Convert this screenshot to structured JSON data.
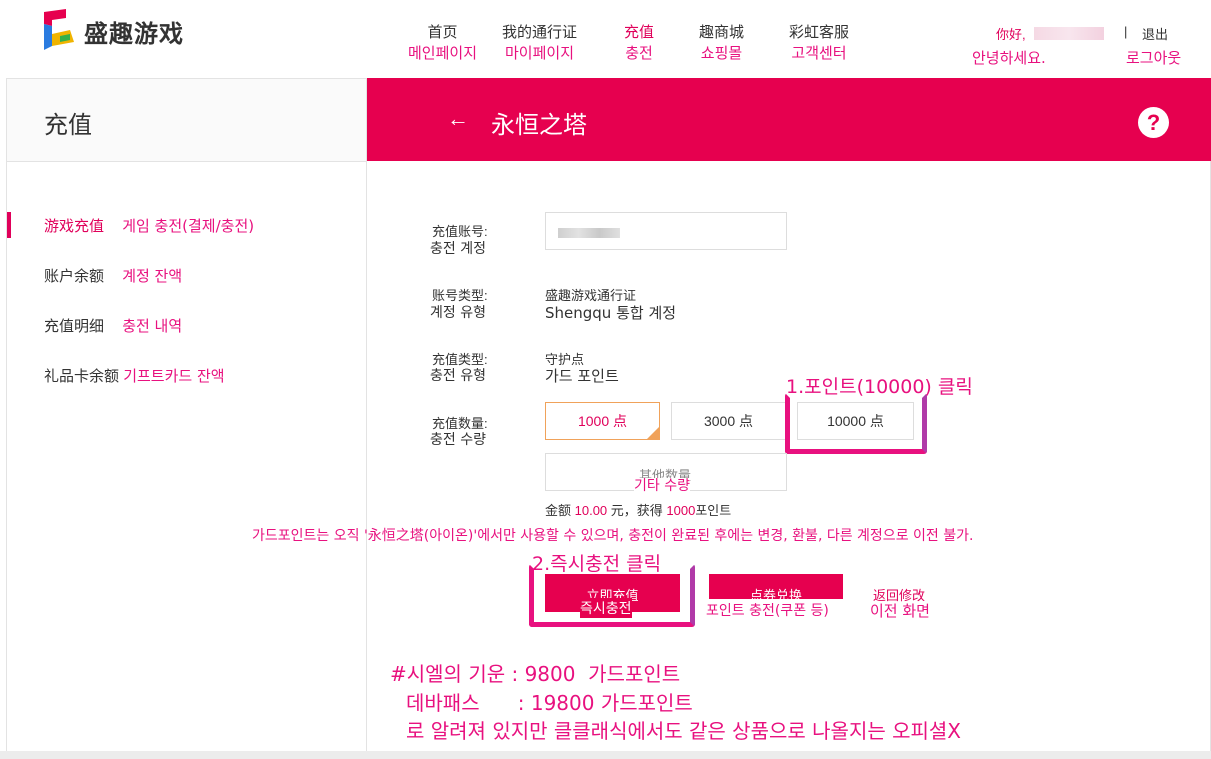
{
  "header": {
    "logo_text": "盛趣游戏",
    "nav": [
      {
        "cn": "首页",
        "kr": "메인페이지"
      },
      {
        "cn": "我的通行证",
        "kr": "마이페이지"
      },
      {
        "cn": "充值",
        "kr": "충전"
      },
      {
        "cn": "趣商城",
        "kr": "쇼핑몰"
      },
      {
        "cn": "彩虹客服",
        "kr": "고객센터"
      }
    ],
    "greeting_cn": "你好,",
    "greeting_kr": "안녕하세요.",
    "separator": "|",
    "logout_cn": "退出",
    "logout_kr": "로그아웃"
  },
  "sidebar": {
    "title": "充值",
    "items": [
      {
        "cn": "游戏充值",
        "kr": "게임 충전(결제/충전)"
      },
      {
        "cn": "账户余额",
        "kr": "계정 잔액"
      },
      {
        "cn": "充值明细",
        "kr": "충전 내역"
      },
      {
        "cn": "礼品卡余额",
        "kr": "기프트카드 잔액"
      }
    ]
  },
  "banner": {
    "back_arrow": "←",
    "title": "永恒之塔",
    "help": "?"
  },
  "form": {
    "account_label_cn": "充值账号:",
    "account_label_kr": "충전 계정",
    "type_label_cn": "账号类型:",
    "type_label_kr": "계정 유형",
    "type_value_cn": "盛趣游戏通行证",
    "type_value_kr": "Shengqu 통합 계정",
    "charge_type_label_cn": "充值类型:",
    "charge_type_label_kr": "충전 유형",
    "charge_type_value_cn": "守护点",
    "charge_type_value_kr": "가드 포인트",
    "amount_label_cn": "充值数量:",
    "amount_label_kr": "충전 수량",
    "options": [
      "1000 点",
      "3000 点",
      "10000 点"
    ],
    "other_cn": "其他数量",
    "other_kr": "기타 수량",
    "summary_a": "金额 ",
    "summary_amount": "10.00",
    "summary_b": " 元，获得 ",
    "summary_points": "1000",
    "summary_c": "포인트"
  },
  "notice": "가드포인트는 오직 '永恒之塔(아이온)'에서만 사용할 수 있으며, 충전이 완료된 후에는 변경, 환불, 다른 계정으로 이전 불가.",
  "annotations": {
    "step1": "1.포인트(10000) 클릭",
    "step2": "2.즉시충전 클릭"
  },
  "buttons": {
    "charge_cn": "立即充值",
    "charge_kr": "즉시충전",
    "coupon_cn": "点券兑换",
    "coupon_kr": "포인트 충전(쿠폰 등)",
    "back_cn": "返回修改",
    "back_kr": "이전 화면"
  },
  "bottom_note": {
    "line1": "#시엘의 기운 : 9800  가드포인트",
    "line2": "데바패스      : 19800 가드포인트",
    "line3": "로 알려져 있지만 클클래식에서도 같은 상품으로 나올지는 오피셜X"
  },
  "colors": {
    "accent": "#e6004f",
    "annotation": "#e8117f",
    "highlight_box": "#e8117f"
  }
}
